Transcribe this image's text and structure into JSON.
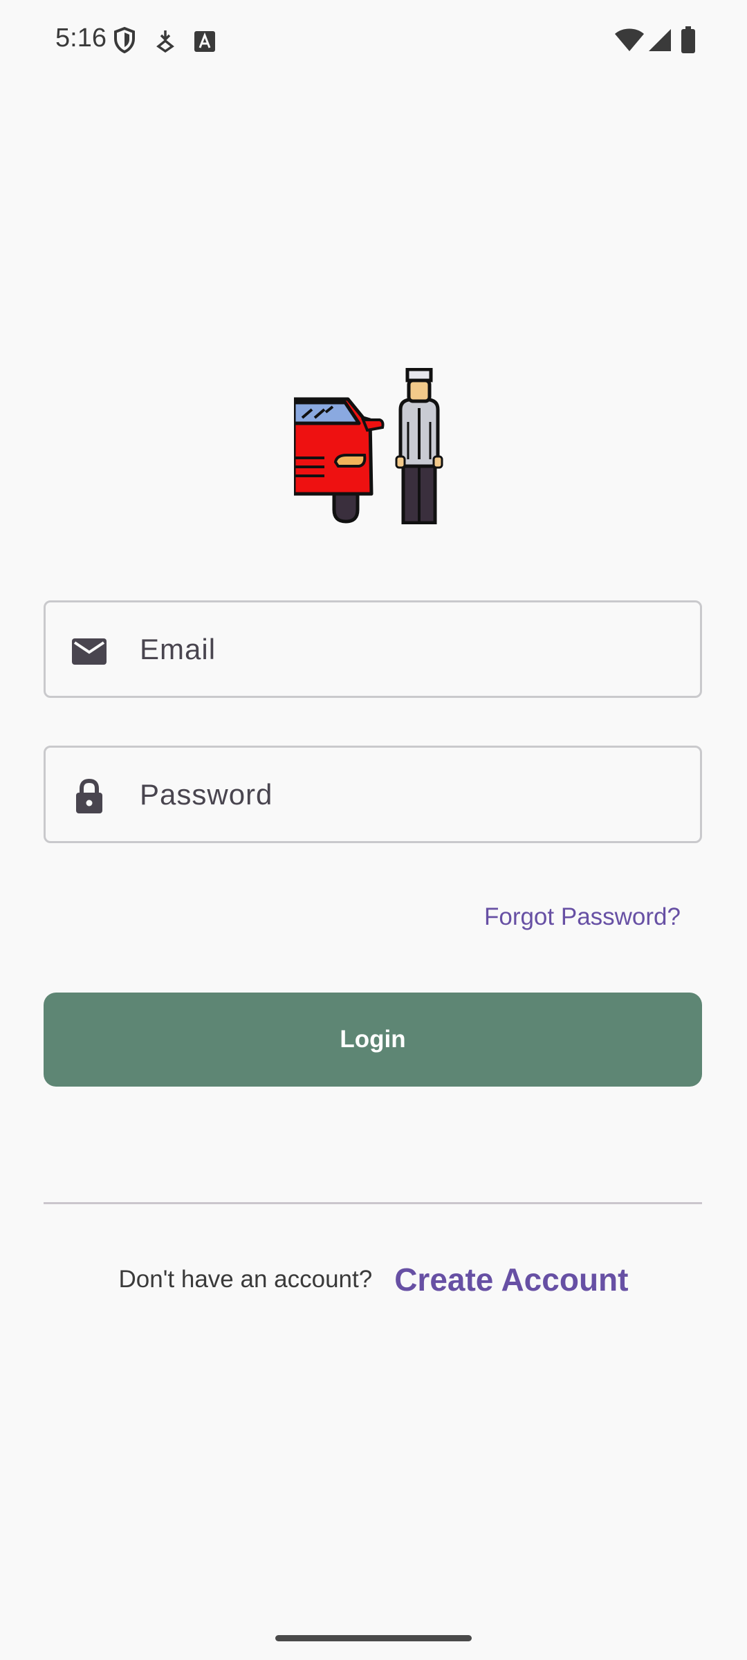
{
  "status_bar": {
    "time": "5:16",
    "icons": [
      "shield-icon",
      "download-icon",
      "keyboard-a-icon",
      "wifi-icon",
      "signal-icon",
      "battery-icon"
    ]
  },
  "logo": {
    "icon": "car-and-valet-logo"
  },
  "form": {
    "email": {
      "placeholder": "Email",
      "icon": "mail-icon"
    },
    "password": {
      "placeholder": "Password",
      "icon": "lock-icon"
    },
    "forgot_password": "Forgot Password?",
    "login_label": "Login"
  },
  "signup": {
    "prompt": "Don't have an account?",
    "link": "Create Account"
  },
  "colors": {
    "accent": "#6750a4",
    "button": "#5e8674",
    "background": "#f9f9f9",
    "field_border": "#c9c9cc"
  }
}
